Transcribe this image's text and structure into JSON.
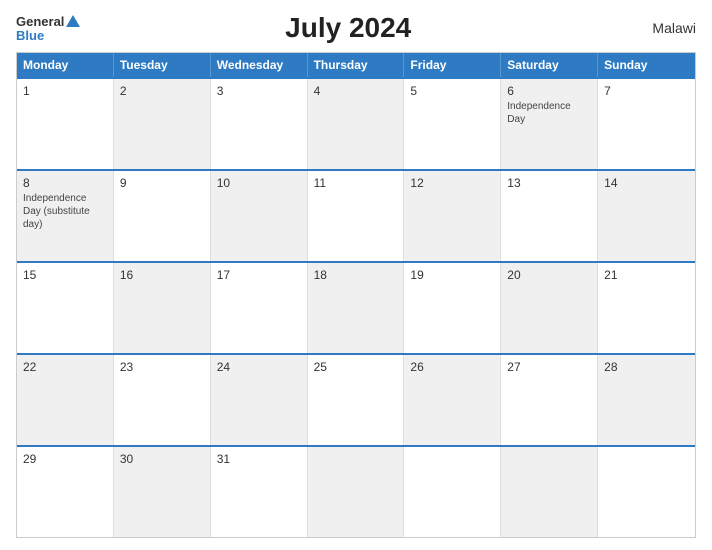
{
  "header": {
    "logo_general": "General",
    "logo_blue": "Blue",
    "title": "July 2024",
    "country": "Malawi"
  },
  "calendar": {
    "days_of_week": [
      "Monday",
      "Tuesday",
      "Wednesday",
      "Thursday",
      "Friday",
      "Saturday",
      "Sunday"
    ],
    "weeks": [
      [
        {
          "day": "1",
          "event": "",
          "alt": false
        },
        {
          "day": "2",
          "event": "",
          "alt": true
        },
        {
          "day": "3",
          "event": "",
          "alt": false
        },
        {
          "day": "4",
          "event": "",
          "alt": true
        },
        {
          "day": "5",
          "event": "",
          "alt": false
        },
        {
          "day": "6",
          "event": "Independence Day",
          "alt": true
        },
        {
          "day": "7",
          "event": "",
          "alt": false
        }
      ],
      [
        {
          "day": "8",
          "event": "Independence Day (substitute day)",
          "alt": true
        },
        {
          "day": "9",
          "event": "",
          "alt": false
        },
        {
          "day": "10",
          "event": "",
          "alt": true
        },
        {
          "day": "11",
          "event": "",
          "alt": false
        },
        {
          "day": "12",
          "event": "",
          "alt": true
        },
        {
          "day": "13",
          "event": "",
          "alt": false
        },
        {
          "day": "14",
          "event": "",
          "alt": true
        }
      ],
      [
        {
          "day": "15",
          "event": "",
          "alt": false
        },
        {
          "day": "16",
          "event": "",
          "alt": true
        },
        {
          "day": "17",
          "event": "",
          "alt": false
        },
        {
          "day": "18",
          "event": "",
          "alt": true
        },
        {
          "day": "19",
          "event": "",
          "alt": false
        },
        {
          "day": "20",
          "event": "",
          "alt": true
        },
        {
          "day": "21",
          "event": "",
          "alt": false
        }
      ],
      [
        {
          "day": "22",
          "event": "",
          "alt": true
        },
        {
          "day": "23",
          "event": "",
          "alt": false
        },
        {
          "day": "24",
          "event": "",
          "alt": true
        },
        {
          "day": "25",
          "event": "",
          "alt": false
        },
        {
          "day": "26",
          "event": "",
          "alt": true
        },
        {
          "day": "27",
          "event": "",
          "alt": false
        },
        {
          "day": "28",
          "event": "",
          "alt": true
        }
      ],
      [
        {
          "day": "29",
          "event": "",
          "alt": false
        },
        {
          "day": "30",
          "event": "",
          "alt": true
        },
        {
          "day": "31",
          "event": "",
          "alt": false
        },
        {
          "day": "",
          "event": "",
          "alt": true
        },
        {
          "day": "",
          "event": "",
          "alt": false
        },
        {
          "day": "",
          "event": "",
          "alt": true
        },
        {
          "day": "",
          "event": "",
          "alt": false
        }
      ]
    ]
  }
}
